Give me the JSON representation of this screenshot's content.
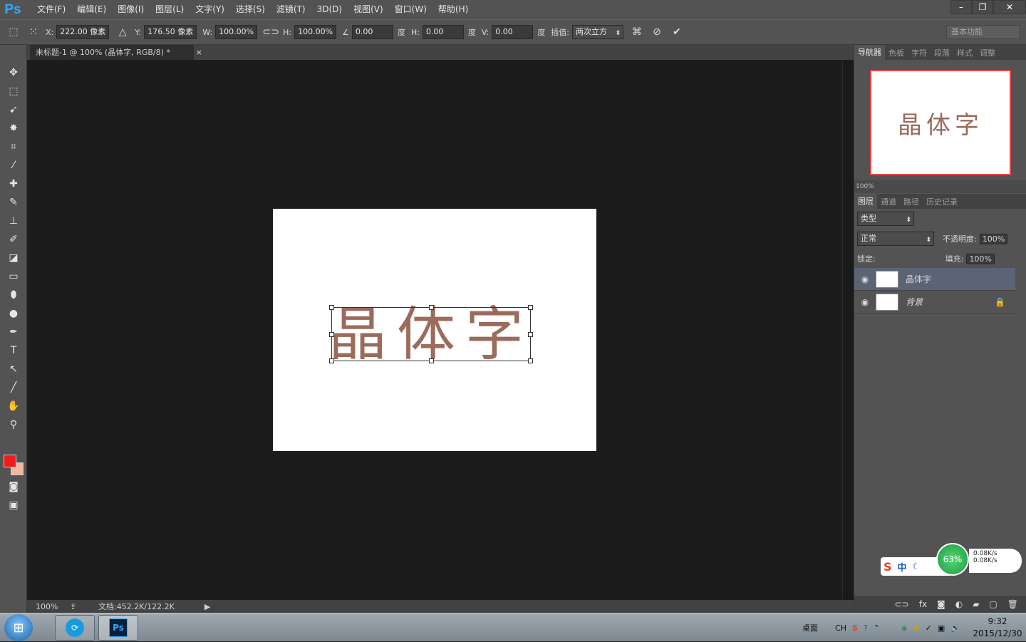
{
  "app": {
    "logo": "Ps"
  },
  "menu": [
    "文件(F)",
    "编辑(E)",
    "图像(I)",
    "图层(L)",
    "文字(Y)",
    "选择(S)",
    "滤镜(T)",
    "3D(D)",
    "视图(V)",
    "窗口(W)",
    "帮助(H)"
  ],
  "window_controls": {
    "minimize": "–",
    "restore": "❐",
    "close": "✕"
  },
  "options": {
    "x_label": "X:",
    "x_value": "222.00 像素",
    "y_label": "Y:",
    "y_value": "176.50 像素",
    "w_label": "W:",
    "w_value": "100.00%",
    "h_label": "H:",
    "h_value": "100.00%",
    "angle_value": "0.00",
    "deg": "度",
    "hskew_label": "H:",
    "hskew_value": "0.00",
    "vskew_label": "V:",
    "vskew_value": "0.00",
    "interp_label": "插值:",
    "interp_value": "两次立方",
    "workspace": "基本功能"
  },
  "tab": {
    "title": "未标题-1 @ 100% (晶体字, RGB/8) *",
    "close": "×"
  },
  "document": {
    "text": "晶体字",
    "text_color": "#9b6b5b"
  },
  "status": {
    "zoom": "100%",
    "doc_info": "文档:452.2K/122.2K"
  },
  "colors": {
    "foreground": "#ee1c1c",
    "background": "#f0b6a0",
    "nav_border": "#e44747"
  },
  "navigator": {
    "tabs": [
      "导航器",
      "色板",
      "字符",
      "段落",
      "样式",
      "调整"
    ],
    "preview_text": "晶体字",
    "zoom": "100%"
  },
  "layers_panel": {
    "tabs": [
      "图层",
      "通道",
      "路径",
      "历史记录"
    ],
    "filter": "类型",
    "blend_mode": "正常",
    "opacity_label": "不透明度:",
    "opacity": "100%",
    "lock_label": "锁定:",
    "fill_label": "填充:",
    "fill": "100%",
    "layers": [
      {
        "name": "晶体字",
        "active": true
      },
      {
        "name": "背景",
        "active": false
      }
    ]
  },
  "ime": {
    "chinese": "中",
    "speed_percent": "63%",
    "up_speed": "0.08K/s",
    "down_speed": "0.08K/s"
  },
  "taskbar": {
    "desktop_label": "桌面",
    "lang": "CH",
    "time": "9:32",
    "date": "2015/12/30"
  }
}
